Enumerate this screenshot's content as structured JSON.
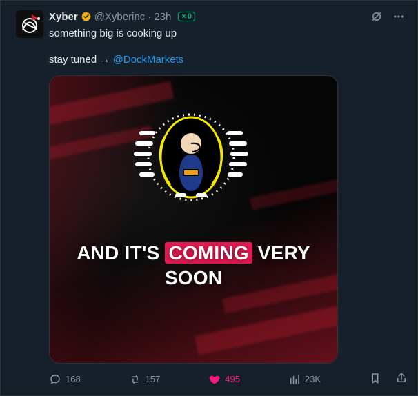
{
  "tweet": {
    "author_name": "Xyber",
    "handle": "@Xyberinc",
    "dot": "·",
    "time": "23h",
    "tag": "0",
    "text": "something big is cooking up",
    "line2_prefix": "stay tuned →",
    "mention": "@DockMarkets",
    "media": {
      "line1_part1": "AND IT'S",
      "line1_highlight": "COMING",
      "line1_part2": "VERY",
      "line2": "SOON"
    },
    "actions": {
      "replies": "168",
      "reposts": "157",
      "likes": "495",
      "views": "23K"
    }
  },
  "icons": {
    "verified": "verified-badge-icon",
    "grok": "grok-icon",
    "more": "more-icon",
    "reply": "reply-icon",
    "repost": "repost-icon",
    "like": "heart-icon",
    "views": "views-icon",
    "bookmark": "bookmark-icon",
    "share": "share-icon"
  },
  "colors": {
    "bg": "#15202b",
    "accent": "#1d9bf0",
    "like": "#f91880",
    "muted": "#8b98a5",
    "highlight": "#e31b54",
    "tag": "#00ba7c"
  }
}
